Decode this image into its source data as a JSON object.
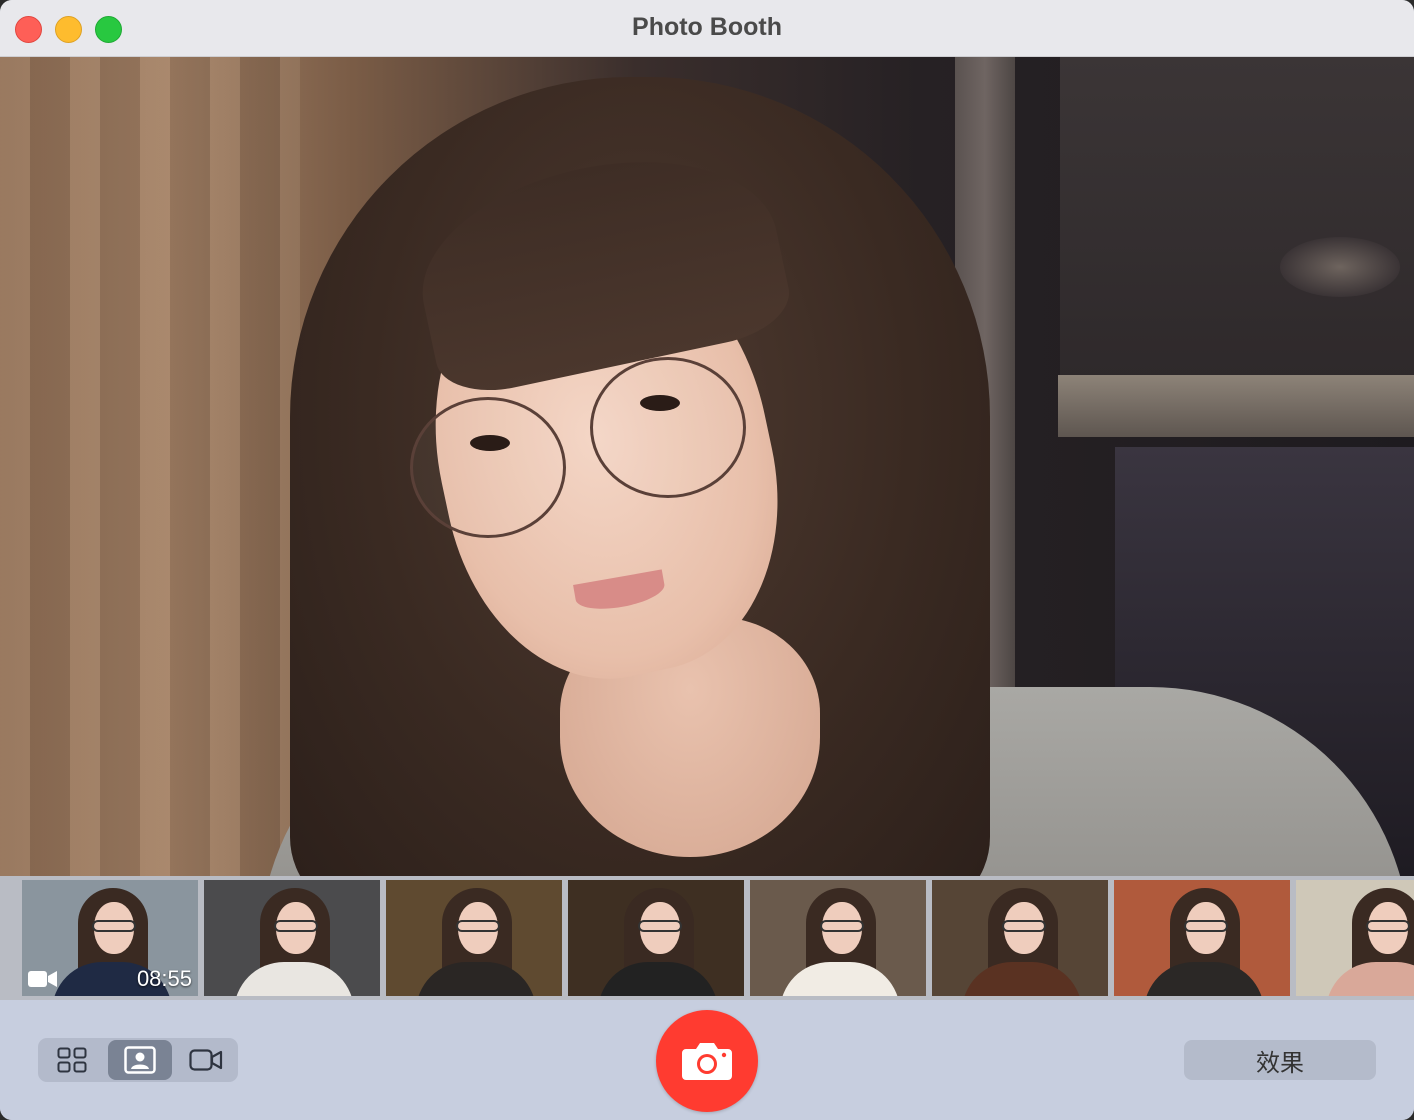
{
  "window": {
    "title": "Photo Booth"
  },
  "thumbnails": [
    {
      "kind": "video",
      "duration": "08:55",
      "icon": "video-camera-icon",
      "bg": "#8a959e",
      "body": "#1f2a44"
    },
    {
      "kind": "photo",
      "bg": "#4b4b4d",
      "body": "#e9e6e1"
    },
    {
      "kind": "photo",
      "bg": "#5f4a30",
      "body": "#2a2624"
    },
    {
      "kind": "photo",
      "bg": "#3e2f22",
      "body": "#222"
    },
    {
      "kind": "photo",
      "bg": "#6a5a4c",
      "body": "#f1ece4"
    },
    {
      "kind": "photo",
      "bg": "#564536",
      "body": "#5a3222"
    },
    {
      "kind": "photo",
      "bg": "#b05a3c",
      "body": "#2b2826"
    },
    {
      "kind": "photo",
      "bg": "#cfc8b8",
      "body": "#d9a899"
    }
  ],
  "toolbar": {
    "view_modes": [
      {
        "name": "grid",
        "icon": "grid-icon",
        "selected": false
      },
      {
        "name": "photo",
        "icon": "portrait-photo-icon",
        "selected": true
      },
      {
        "name": "video",
        "icon": "video-camera-icon",
        "selected": false
      }
    ],
    "shutter_icon": "camera-icon",
    "effects_label": "效果"
  },
  "colors": {
    "shutter": "#ff3b30",
    "toolbar_bg": "#c7cedf",
    "selected_segment": "#7a8394"
  }
}
